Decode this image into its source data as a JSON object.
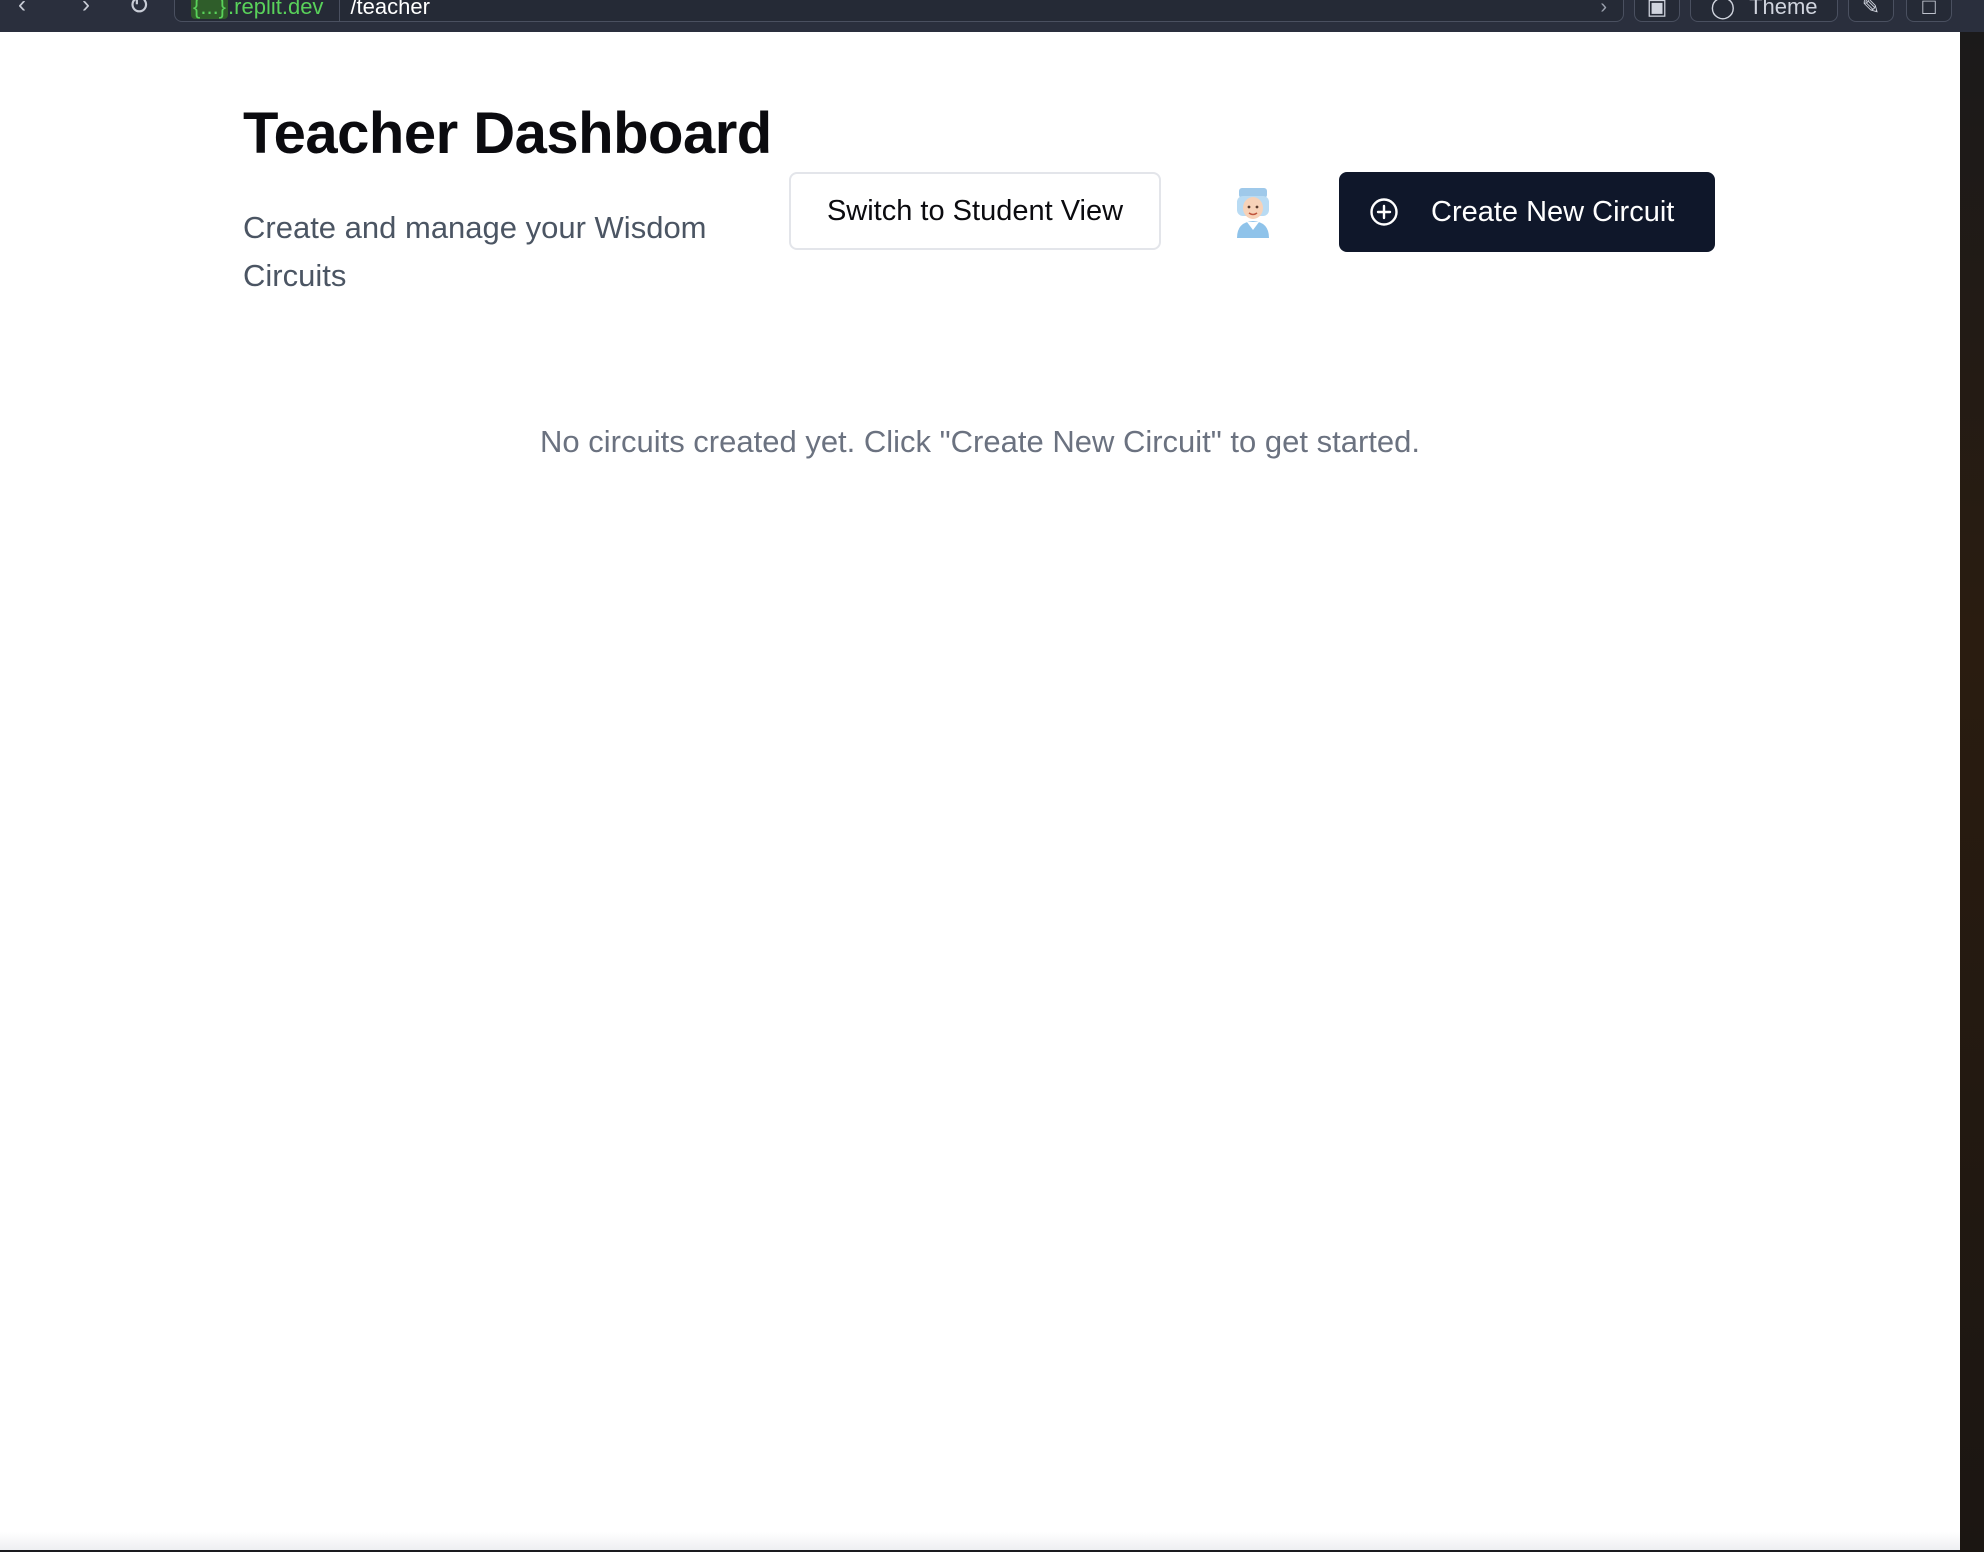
{
  "browser": {
    "address_host": "{...}.replit.dev",
    "address_host_prefix": "{...}",
    "address_host_suffix": ".replit.dev",
    "address_path": "/teacher",
    "theme_label": "Theme"
  },
  "header": {
    "title": "Teacher Dashboard",
    "subtitle": "Create and manage your Wisdom Circuits",
    "switch_view_label": "Switch to Student View",
    "create_label": "Create New Circuit"
  },
  "main": {
    "empty_message": "No circuits created yet. Click \"Create New Circuit\" to get started."
  },
  "colors": {
    "primary_button_bg": "#0f172a",
    "subtitle_text": "#4b5563",
    "empty_text": "#6b7280"
  }
}
